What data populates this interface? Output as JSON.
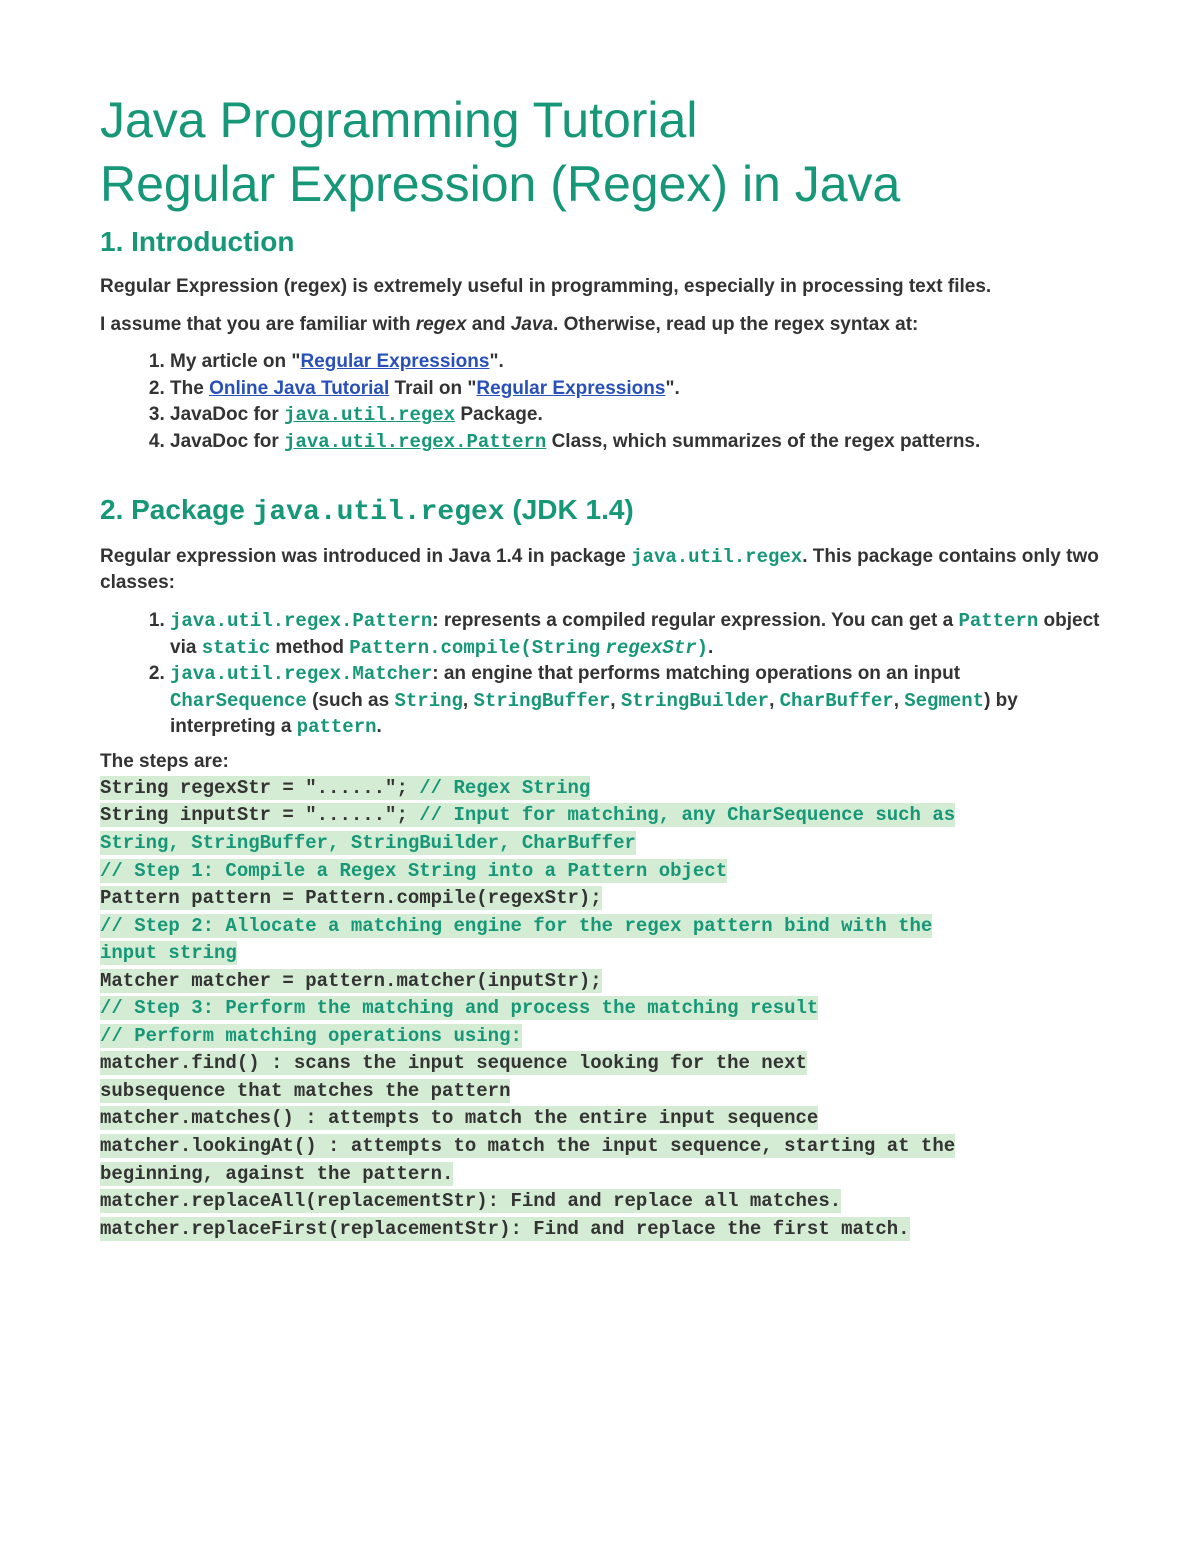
{
  "title_line1": "Java Programming Tutorial",
  "title_line2": "Regular Expression (Regex) in Java",
  "section1": {
    "heading": "1.  Introduction",
    "para1": "Regular Expression (regex) is extremely useful in programming, especially in processing text files.",
    "para2_a": "I assume that you are familiar with ",
    "para2_em1": "regex",
    "para2_b": " and ",
    "para2_em2": "Java",
    "para2_c": ". Otherwise, read up the regex syntax at:",
    "li1_a": "My article on \"",
    "li1_link": "Regular Expressions",
    "li1_b": "\".",
    "li2_a": "The ",
    "li2_link1": "Online Java Tutorial",
    "li2_b": " Trail on \"",
    "li2_link2": "Regular Expressions",
    "li2_c": "\".",
    "li3_a": "JavaDoc for ",
    "li3_link": "java.util.regex",
    "li3_b": " Package.",
    "li4_a": "JavaDoc for ",
    "li4_link": "java.util.regex.Pattern",
    "li4_b": " Class, which summarizes of the regex patterns."
  },
  "section2": {
    "heading_a": "2.  Package ",
    "heading_mono": "java.util.regex",
    "heading_b": " (JDK 1.4)",
    "para1_a": "Regular expression was introduced in Java 1.4 in package ",
    "para1_mono": "java.util.regex",
    "para1_b": ". This package contains only two classes:",
    "li1_mono": "java.util.regex.Pattern",
    "li1_a": ": represents a compiled regular expression. You can get a ",
    "li1_mono2": "Pattern",
    "li1_b": " object via ",
    "li1_mono3": "static",
    "li1_c": " method ",
    "li1_mono4": "Pattern.compile(String",
    "li1_mono5": "regexStr",
    "li1_mono6": ")",
    "li1_d": ".",
    "li2_mono": "java.util.regex.Matcher",
    "li2_a": ": an engine that performs matching operations on an input ",
    "li2_mono2": "CharSequence",
    "li2_b": " (such as ",
    "li2_mono3": "String",
    "li2_c": ", ",
    "li2_mono4": "StringBuffer",
    "li2_d": ", ",
    "li2_mono5": "StringBuilder",
    "li2_e": ", ",
    "li2_mono6": "CharBuffer",
    "li2_f": ", ",
    "li2_mono7": "Segment",
    "li2_g": ") by interpreting a ",
    "li2_mono8": "pattern",
    "li2_h": "."
  },
  "steps_label": "The steps are:",
  "code": {
    "l1a": "String regexStr = \"......\";   ",
    "l1b": "// Regex String",
    "l2a": "String inputStr = \"......\";   ",
    "l2b": "// Input for matching, any CharSequence such as ",
    "l3": "String, StringBuffer, StringBuilder, CharBuffer",
    "l4": "// Step 1: Compile a Regex String into a Pattern object",
    "l5": "Pattern pattern = Pattern.compile(regexStr);",
    "l6a": "// Step 2: Allocate a matching engine for the regex pattern bind with the ",
    "l6b": "input string",
    "l7": "Matcher matcher = pattern.matcher(inputStr);",
    "l8": "// Step 3: Perform the matching and process the matching result",
    "l9": "// Perform matching operations using:",
    "l10a": "matcher.find()      : scans the input sequence looking for the next ",
    "l10b": "subsequence that matches the pattern",
    "l11": "matcher.matches()   : attempts to match the entire input sequence",
    "l12a": "matcher.lookingAt() : attempts to match the input sequence, starting at the ",
    "l12b": "beginning, against the pattern.",
    "l13": "matcher.replaceAll(replacementStr):   Find and replace all matches.",
    "l14": "matcher.replaceFirst(replacementStr): Find and replace the first match."
  }
}
